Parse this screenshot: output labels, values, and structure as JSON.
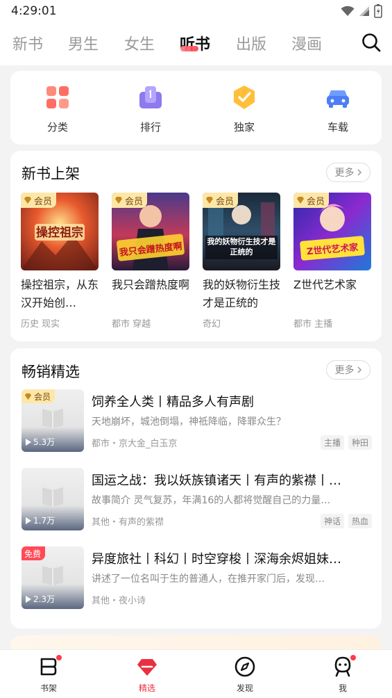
{
  "status_bar": {
    "time": "4:29:01"
  },
  "top_tabs": [
    {
      "label": "新书",
      "active": false
    },
    {
      "label": "男生",
      "active": false
    },
    {
      "label": "女生",
      "active": false
    },
    {
      "label": "听书",
      "active": true
    },
    {
      "label": "出版",
      "active": false
    },
    {
      "label": "漫画",
      "active": false
    }
  ],
  "quick_entries": [
    {
      "label": "分类",
      "icon": "category-grid-icon"
    },
    {
      "label": "排行",
      "icon": "ranking-icon"
    },
    {
      "label": "独家",
      "icon": "exclusive-badge-icon"
    },
    {
      "label": "车载",
      "icon": "car-icon"
    }
  ],
  "new_books": {
    "title": "新书上架",
    "more_label": "更多",
    "items": [
      {
        "badge": "会员",
        "title": "操控祖宗，从东汉开始创…",
        "tags": "历史 现实",
        "cover_text": "操控祖宗"
      },
      {
        "badge": "会员",
        "title": "我只会蹭热度啊",
        "tags": "都市 穿越",
        "cover_text": "我只会蹭热度啊"
      },
      {
        "badge": "会员",
        "title": "我的妖物衍生技才是正统的",
        "tags": "奇幻",
        "cover_text": "我的妖物衍生技才是正统的"
      },
      {
        "badge": "会员",
        "title": "Z世代艺术家",
        "tags": "都市 主播",
        "cover_text": "Z世代艺术家"
      }
    ]
  },
  "bestsellers": {
    "title": "畅销精选",
    "more_label": "更多",
    "items": [
      {
        "badge": "会员",
        "badge_type": "vip",
        "plays": "5.3万",
        "title": "饲养全人类丨精品多人有声剧",
        "desc": "天地崩坏，城池倒塌，神祗降临，降罪众生？",
        "meta": "都市・京大金_白玉京",
        "tags": [
          "主播",
          "种田"
        ]
      },
      {
        "badge": "",
        "badge_type": "none",
        "plays": "1.7万",
        "title": "国运之战：我以妖族镇诸天丨有声的紫襟丨…",
        "desc": "故事简介 灵气复苏，年满16的人都将觉醒自己的力量…",
        "meta": "其他・有声的紫襟",
        "tags": [
          "神话",
          "热血"
        ]
      },
      {
        "badge": "免费",
        "badge_type": "free",
        "plays": "2.3万",
        "title": "异度旅社丨科幻丨时空穿梭丨深海余烬姐妹…",
        "desc": "讲述了一位名叫于生的普通人，在推开家门后，发现…",
        "meta": "其他・夜小诗",
        "tags": []
      }
    ]
  },
  "bottom_nav": [
    {
      "label": "书架",
      "active": false,
      "dot": true
    },
    {
      "label": "精选",
      "active": true,
      "dot": false
    },
    {
      "label": "发现",
      "active": false,
      "dot": false
    },
    {
      "label": "我",
      "active": false,
      "dot": true
    }
  ],
  "colors": {
    "accent": "#e8303f",
    "vip_bg": "#fde7a8",
    "free_bg": "#ff4b57"
  }
}
